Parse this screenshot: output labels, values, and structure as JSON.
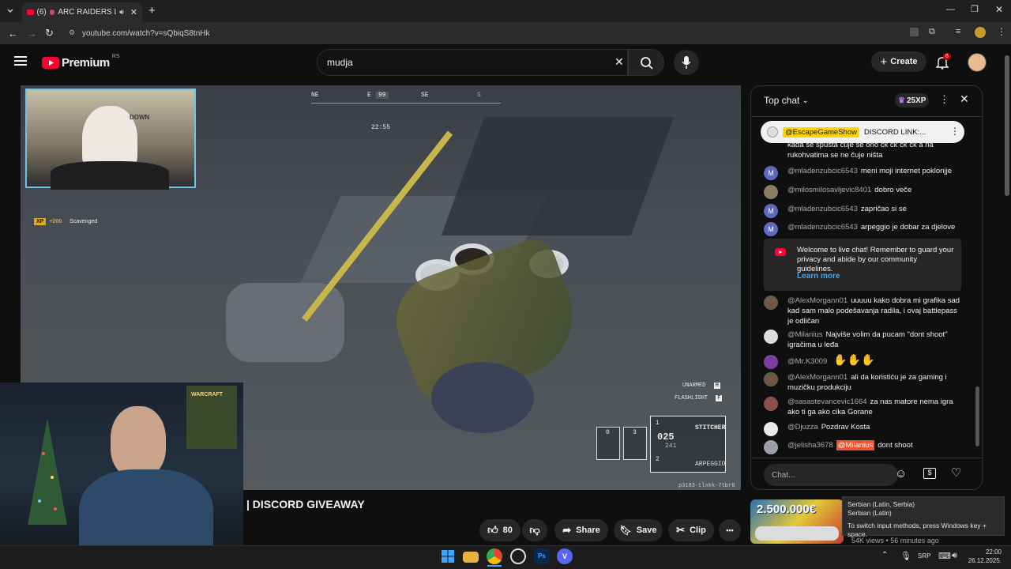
{
  "browser": {
    "tab_count_badge": "(6)",
    "tab_title": "ARC RAIDERS LIVE -",
    "url": "youtube.com/watch?v=sQbiqS8tnHk",
    "new_tab_symbol": "+"
  },
  "header": {
    "logo_text": "Premium",
    "region": "RS",
    "search_value": "mudja",
    "create_label": "Create",
    "notification_count": "6"
  },
  "video": {
    "compass": [
      "NE",
      "E",
      "99",
      "SE",
      "S"
    ],
    "timer": "22:55",
    "xp_tag": "XP",
    "xp_amount": "+200",
    "xp_reason": "Scavenged",
    "hud_unarmed": "UNARMED",
    "hud_unarmed_key": "H",
    "hud_flashlight": "FLASHLIGHT",
    "hud_flashlight_key": "F",
    "slot0": "0",
    "slot3": "3",
    "weapon_slot1": "1",
    "weapon_name": "STITCHER",
    "ammo_current": "025",
    "ammo_reserve": "241",
    "weapon_slot2": "2",
    "weapon2_name": "ARPEGGIO",
    "code": "p3183-tlxkk-7tbr8",
    "cam_text": "DOWN",
    "poster_text": "WARCRAFT"
  },
  "title_fragment": "| DISCORD GIVEAWAY",
  "actions": {
    "like_count": "80",
    "share_label": "Share",
    "save_label": "Save",
    "clip_label": "Clip",
    "more": "•••"
  },
  "chat": {
    "header_label": "Top chat",
    "xp_label": "25XP",
    "pinned_user": "@EscapeGameShow",
    "pinned_text": "DISCORD LINK:...",
    "partial_text": "kada se spušta čuje se ono ck ck ck ck a na rukohvatima se ne čuje ništa",
    "messages": [
      {
        "avatar": "M",
        "user": "@mladenzubcic6543",
        "text": "meni moji internet poklonjje"
      },
      {
        "avatar": "",
        "user": "@milosmilosavljevic8401",
        "text": "dobro veče"
      },
      {
        "avatar": "M",
        "user": "@mladenzubcic6543",
        "text": "zapričao si se"
      },
      {
        "avatar": "M",
        "user": "@mladenzubcic6543",
        "text": "arpeggio je dobar za djelove"
      }
    ],
    "welcome_text": "Welcome to live chat! Remember to guard your privacy and abide by our community guidelines.",
    "learn_more": "Learn more",
    "messages2": [
      {
        "avatar": "",
        "user": "@AlexMorgann01",
        "text": "uuuuu kako dobra mi grafika sad kad sam malo podešavanja radila, i ovaj battlepass je odličan"
      },
      {
        "avatar": "",
        "user": "@Milanius",
        "text": "Najviše volim da pucam \"dont shoot\" igračima u leđa"
      },
      {
        "avatar": "",
        "user": "@Mr.K3009",
        "text": ""
      },
      {
        "avatar": "",
        "user": "@AlexMorgann01",
        "text": "ali da koristiću je za gaming i muzičku produkciju"
      },
      {
        "avatar": "",
        "user": "@sasastevancevic1664",
        "text": "za nas matore nema igra ako ti ga ako cika Gorane"
      },
      {
        "avatar": "",
        "user": "@Djuzza",
        "text": "Pozdrav Kosta"
      },
      {
        "avatar": "",
        "user": "@jelisha3678",
        "text": "dont shoot",
        "mention": "@Milanius"
      }
    ],
    "input_placeholder": "Chat..."
  },
  "suggestion": {
    "thumb_text": "2.500.000€",
    "views": "54K views",
    "age": "56 minutes ago"
  },
  "ime_tooltip": {
    "line1": "Serbian (Latin, Serbia)",
    "line2": "Serbian (Latin)",
    "line3": "To switch input methods, press Windows key + space."
  },
  "taskbar": {
    "lang": "SRP",
    "time": "22:00",
    "date": "26.12.2025."
  }
}
